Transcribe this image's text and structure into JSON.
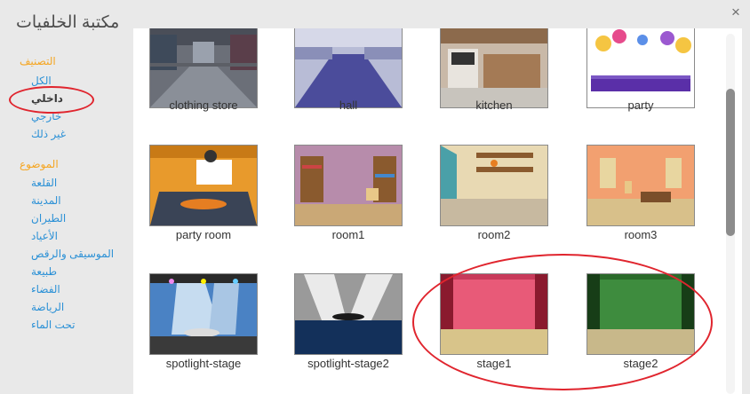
{
  "dialog": {
    "title": "مكتبة الخلفيات",
    "close_glyph": "×"
  },
  "sidebar": {
    "category_heading": "التصنيف",
    "categories": [
      {
        "label": "الكل",
        "selected": false
      },
      {
        "label": "داخلي",
        "selected": true
      },
      {
        "label": "خارجي",
        "selected": false
      },
      {
        "label": "غير ذلك",
        "selected": false
      }
    ],
    "theme_heading": "الموضوع",
    "themes": [
      "القلعة",
      "المدينة",
      "الطيران",
      "الأعياد",
      "الموسيقى والرقص",
      "طبيعة",
      "الفضاء",
      "الرياضة",
      "تحت الماء"
    ]
  },
  "backdrops": [
    {
      "name": "clothing store",
      "icon": "clothing-store-thumbnail"
    },
    {
      "name": "hall",
      "icon": "hall-thumbnail"
    },
    {
      "name": "kitchen",
      "icon": "kitchen-thumbnail"
    },
    {
      "name": "party",
      "icon": "party-thumbnail"
    },
    {
      "name": "party room",
      "icon": "party-room-thumbnail"
    },
    {
      "name": "room1",
      "icon": "room1-thumbnail"
    },
    {
      "name": "room2",
      "icon": "room2-thumbnail"
    },
    {
      "name": "room3",
      "icon": "room3-thumbnail"
    },
    {
      "name": "spotlight-stage",
      "icon": "spotlight-stage-thumbnail"
    },
    {
      "name": "spotlight-stage2",
      "icon": "spotlight-stage2-thumbnail"
    },
    {
      "name": "stage1",
      "icon": "stage1-thumbnail"
    },
    {
      "name": "stage2",
      "icon": "stage2-thumbnail"
    }
  ],
  "colors": {
    "heading": "#f5a623",
    "link": "#2c91d6",
    "annotation": "#e0252e"
  }
}
